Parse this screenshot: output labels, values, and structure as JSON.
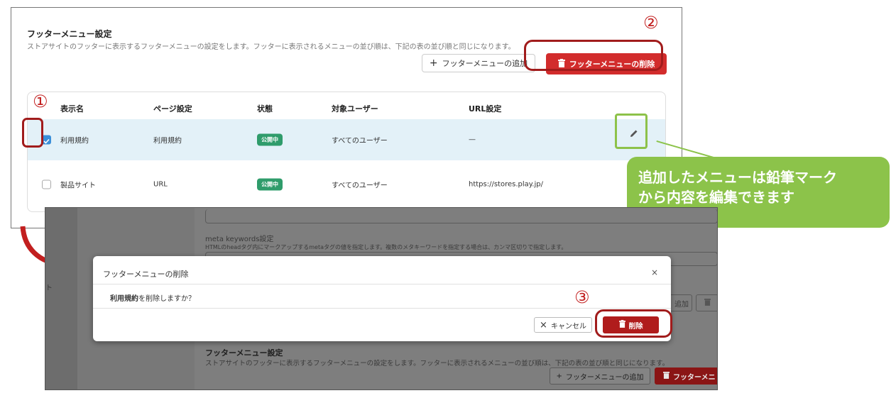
{
  "panel1": {
    "title": "フッターメニュー設定",
    "description": "ストアサイトのフッターに表示するフッターメニューの設定をします。フッターに表示されるメニューの並び順は、下記の表の並び順と同じになります。",
    "add_button": "フッターメニューの追加",
    "delete_button": "フッターメニューの削除",
    "table": {
      "headers": [
        "表示名",
        "ページ設定",
        "状態",
        "対象ユーザー",
        "URL設定"
      ],
      "rows": [
        {
          "name": "利用規約",
          "page": "利用規約",
          "status": "公開中",
          "users": "すべてのユーザー",
          "url": "—",
          "checked": true
        },
        {
          "name": "製品サイト",
          "page": "URL",
          "status": "公開中",
          "users": "すべてのユーザー",
          "url": "https://stores.play.jp/",
          "checked": false
        }
      ]
    }
  },
  "step_numbers": [
    "①",
    "②",
    "③"
  ],
  "callout": {
    "line1": "追加したメニューは鉛筆マーク",
    "line2": "から内容を編集できます"
  },
  "panel2": {
    "meta_keywords_title": "meta keywords設定",
    "meta_keywords_desc": "HTMLのheadタグ内にマークアップするmetaタグの値を指定します。複数のメタキーワードを指定する場合は、カンマ区切りで指定します。",
    "bg_title": "フッターメニュー設定",
    "bg_desc": "ストアサイトのフッターに表示するフッターメニューの設定をします。フッターに表示されるメニューの並び順は、下記の表の並び順と同じになります。",
    "bg_add_button": "フッターメニューの追加",
    "bg_delete_button": "フッターメニ",
    "bg_side_char": "ト",
    "bg_add_partial": "追加"
  },
  "modal": {
    "title": "フッターメニューの削除",
    "close": "×",
    "body_bold": "利用規約",
    "body_rest": "を削除しますか？",
    "cancel_label": "キャンセル",
    "delete_label": "削除"
  },
  "colors": {
    "danger": "#d22c2c",
    "danger_dark": "#b01c1c",
    "highlight_red": "#a11c1c",
    "callout_green": "#8cc34a",
    "badge_green": "#2f9c6b",
    "selected_row": "#e3f1f8",
    "checkbox_blue": "#3b8fd9"
  }
}
